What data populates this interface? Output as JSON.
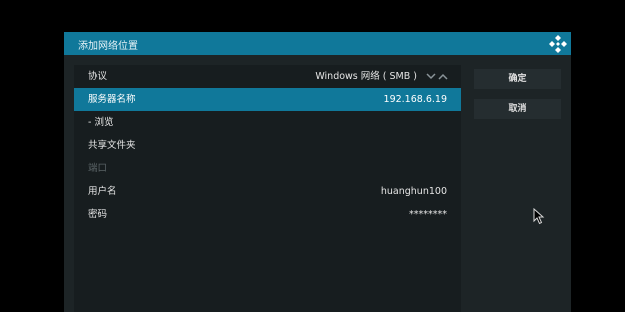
{
  "dialog": {
    "title": "添加网络位置"
  },
  "fields": [
    {
      "label": "协议",
      "value": "Windows 网络 ( SMB )",
      "state": "normal"
    },
    {
      "label": "服务器名称",
      "value": "192.168.6.19",
      "state": "selected"
    },
    {
      "label": "- 浏览",
      "value": "",
      "state": "normal"
    },
    {
      "label": "共享文件夹",
      "value": "",
      "state": "normal"
    },
    {
      "label": "端口",
      "value": "",
      "state": "disabled"
    },
    {
      "label": "用户名",
      "value": "huanghun100",
      "state": "normal"
    },
    {
      "label": "密码",
      "value": "********",
      "state": "normal"
    }
  ],
  "buttons": {
    "ok": "确定",
    "cancel": "取消"
  },
  "colors": {
    "accent": "#10789a",
    "background": "#1d2426",
    "panel": "#171d1f"
  },
  "icons": {
    "logo": "kodi-logo-icon",
    "spinner": "up-down-arrows-icon",
    "cursor": "mouse-pointer-icon"
  }
}
